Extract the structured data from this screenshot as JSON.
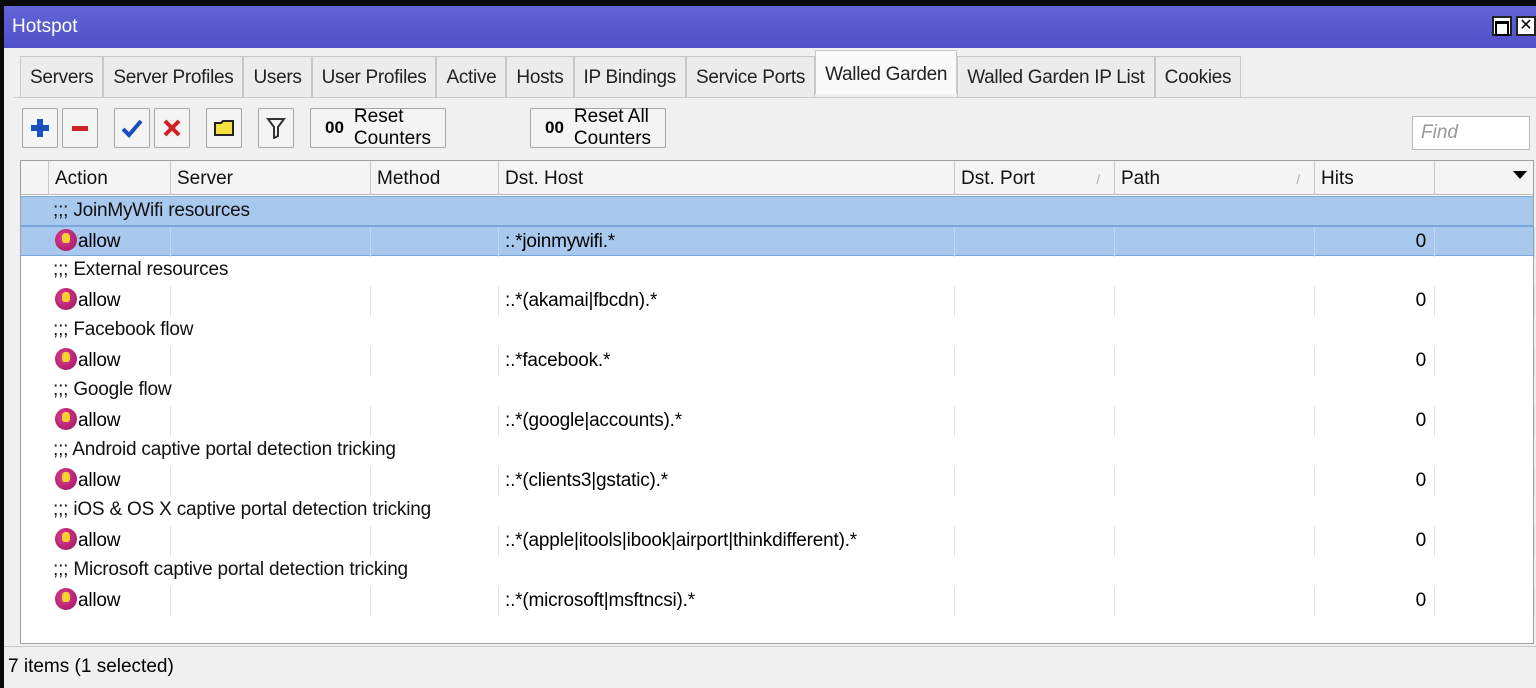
{
  "window": {
    "title": "Hotspot"
  },
  "tabs": [
    {
      "label": "Servers",
      "active": false
    },
    {
      "label": "Server Profiles",
      "active": false
    },
    {
      "label": "Users",
      "active": false
    },
    {
      "label": "User Profiles",
      "active": false
    },
    {
      "label": "Active",
      "active": false
    },
    {
      "label": "Hosts",
      "active": false
    },
    {
      "label": "IP Bindings",
      "active": false
    },
    {
      "label": "Service Ports",
      "active": false
    },
    {
      "label": "Walled Garden",
      "active": true
    },
    {
      "label": "Walled Garden IP List",
      "active": false
    },
    {
      "label": "Cookies",
      "active": false
    }
  ],
  "toolbar": {
    "reset_counters_prefix": "00",
    "reset_counters": "Reset Counters",
    "reset_all_prefix": "00",
    "reset_all_counters": "Reset All Counters",
    "find_placeholder": "Find",
    "icons": [
      "add-icon",
      "remove-icon",
      "enable-icon",
      "disable-icon",
      "comment-icon",
      "filter-icon"
    ]
  },
  "table": {
    "columns": [
      "Action",
      "Server",
      "Method",
      "Dst. Host",
      "Dst. Port",
      "Path",
      "Hits"
    ],
    "rows": [
      {
        "comment": ";;; JoinMyWifi resources",
        "action": "allow",
        "server": "",
        "method": "",
        "dst_host": ":.*joinmywifi.*",
        "dst_port": "",
        "path": "",
        "hits": "0",
        "selected": true
      },
      {
        "comment": ";;; External resources",
        "action": "allow",
        "server": "",
        "method": "",
        "dst_host": ":.*(akamai|fbcdn).*",
        "dst_port": "",
        "path": "",
        "hits": "0",
        "selected": false
      },
      {
        "comment": ";;; Facebook flow",
        "action": "allow",
        "server": "",
        "method": "",
        "dst_host": ":.*facebook.*",
        "dst_port": "",
        "path": "",
        "hits": "0",
        "selected": false
      },
      {
        "comment": ";;; Google flow",
        "action": "allow",
        "server": "",
        "method": "",
        "dst_host": ":.*(google|accounts).*",
        "dst_port": "",
        "path": "",
        "hits": "0",
        "selected": false
      },
      {
        "comment": ";;; Android captive portal detection tricking",
        "action": "allow",
        "server": "",
        "method": "",
        "dst_host": ":.*(clients3|gstatic).*",
        "dst_port": "",
        "path": "",
        "hits": "0",
        "selected": false
      },
      {
        "comment": ";;; iOS & OS X captive portal detection tricking",
        "action": "allow",
        "server": "",
        "method": "",
        "dst_host": ":.*(apple|itools|ibook|airport|thinkdifferent).*",
        "dst_port": "",
        "path": "",
        "hits": "0",
        "selected": false
      },
      {
        "comment": ";;; Microsoft captive portal detection tricking",
        "action": "allow",
        "server": "",
        "method": "",
        "dst_host": ":.*(microsoft|msftncsi).*",
        "dst_port": "",
        "path": "",
        "hits": "0",
        "selected": false
      }
    ]
  },
  "status": {
    "text": "7 items (1 selected)"
  },
  "colors": {
    "titlebar": "#5a5ad0",
    "selection": "#a9c8ee",
    "add": "#1a4fc0",
    "remove": "#d02020",
    "enable": "#1a4fc0",
    "disable": "#d02020"
  }
}
